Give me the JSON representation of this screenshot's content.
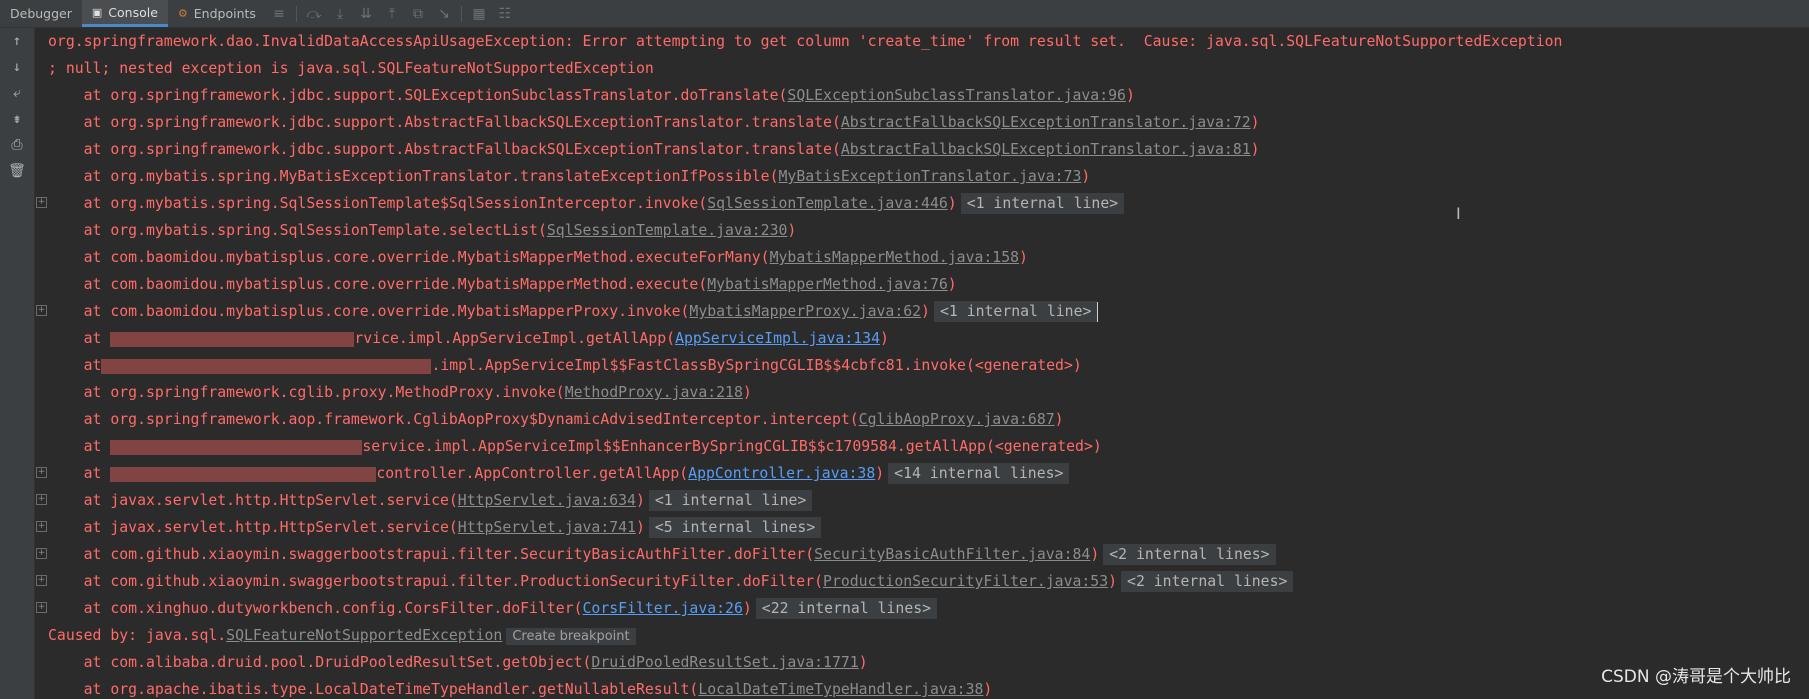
{
  "tabs": [
    {
      "label": "Debugger",
      "icon": ""
    },
    {
      "label": "Console",
      "icon": "console-icon"
    },
    {
      "label": "Endpoints",
      "icon": "endpoints-icon"
    }
  ],
  "toolbar_icons": [
    "menu-icon",
    "step-over-icon",
    "step-into-icon",
    "force-step-into-icon",
    "step-out-icon",
    "drop-frame-icon",
    "run-to-cursor-icon",
    "evaluate-icon",
    "trace-icon"
  ],
  "side_icons": [
    "up-arrow-icon",
    "down-arrow-icon",
    "soft-wrap-icon",
    "scroll-to-end-icon",
    "print-icon",
    "trash-icon"
  ],
  "colors": {
    "error": "#ff6b68",
    "link": "#8c8c8c",
    "link_blue": "#589df6",
    "fold_text": "#b4b4b4"
  },
  "console": {
    "line1": "org.springframework.dao.InvalidDataAccessApiUsageException: Error attempting to get column 'create_time' from result set.  Cause: java.sql.SQLFeatureNotSupportedException",
    "line2": "; null; nested exception is java.sql.SQLFeatureNotSupportedException",
    "frames": [
      {
        "text": "    at org.springframework.jdbc.support.SQLExceptionSubclassTranslator.doTranslate(",
        "link": "SQLExceptionSubclassTranslator.java:96",
        "tail": ")",
        "fold": "",
        "blue": false,
        "gutter": false
      },
      {
        "text": "    at org.springframework.jdbc.support.AbstractFallbackSQLExceptionTranslator.translate(",
        "link": "AbstractFallbackSQLExceptionTranslator.java:72",
        "tail": ")",
        "fold": "",
        "blue": false,
        "gutter": false
      },
      {
        "text": "    at org.springframework.jdbc.support.AbstractFallbackSQLExceptionTranslator.translate(",
        "link": "AbstractFallbackSQLExceptionTranslator.java:81",
        "tail": ")",
        "fold": "",
        "blue": false,
        "gutter": false
      },
      {
        "text": "    at org.mybatis.spring.MyBatisExceptionTranslator.translateExceptionIfPossible(",
        "link": "MyBatisExceptionTranslator.java:73",
        "tail": ")",
        "fold": "",
        "blue": false,
        "gutter": false
      },
      {
        "text": "    at org.mybatis.spring.SqlSessionTemplate$SqlSessionInterceptor.invoke(",
        "link": "SqlSessionTemplate.java:446",
        "tail": ")",
        "fold": "<1 internal line>",
        "blue": false,
        "gutter": true
      },
      {
        "text": "    at org.mybatis.spring.SqlSessionTemplate.selectList(",
        "link": "SqlSessionTemplate.java:230",
        "tail": ")",
        "fold": "",
        "blue": false,
        "gutter": false
      },
      {
        "text": "    at com.baomidou.mybatisplus.core.override.MybatisMapperMethod.executeForMany(",
        "link": "MybatisMapperMethod.java:158",
        "tail": ")",
        "fold": "",
        "blue": false,
        "gutter": false
      },
      {
        "text": "    at com.baomidou.mybatisplus.core.override.MybatisMapperMethod.execute(",
        "link": "MybatisMapperMethod.java:76",
        "tail": ")",
        "fold": "",
        "blue": false,
        "gutter": false
      },
      {
        "text": "    at com.baomidou.mybatisplus.core.override.MybatisMapperProxy.invoke(",
        "link": "MybatisMapperProxy.java:62",
        "tail": ")",
        "fold": "<1 internal line>",
        "blue": false,
        "gutter": true,
        "cursor": true
      },
      {
        "text": "    at ",
        "redact": "r1",
        "text2": "rvice.impl.AppServiceImpl.getAllApp(",
        "link": "AppServiceImpl.java:134",
        "tail": ")",
        "fold": "",
        "blue": true,
        "gutter": false
      },
      {
        "text": "    at",
        "redact": "r2",
        "text2": ".impl.AppServiceImpl$$FastClassBySpringCGLIB$$4cbfc81.invoke(<generated>)",
        "link": "",
        "tail": "",
        "fold": "",
        "blue": false,
        "gutter": false
      },
      {
        "text": "    at org.springframework.cglib.proxy.MethodProxy.invoke(",
        "link": "MethodProxy.java:218",
        "tail": ")",
        "fold": "",
        "blue": false,
        "gutter": false
      },
      {
        "text": "    at org.springframework.aop.framework.CglibAopProxy$DynamicAdvisedInterceptor.intercept(",
        "link": "CglibAopProxy.java:687",
        "tail": ")",
        "fold": "",
        "blue": false,
        "gutter": false
      },
      {
        "text": "    at ",
        "redact": "r3",
        "text2": "service.impl.AppServiceImpl$$EnhancerBySpringCGLIB$$c1709584.getAllApp(<generated>)",
        "link": "",
        "tail": "",
        "fold": "",
        "blue": false,
        "gutter": false
      },
      {
        "text": "    at ",
        "redact": "r4",
        "text2": "controller.AppController.getAllApp(",
        "link": "AppController.java:38",
        "tail": ")",
        "fold": "<14 internal lines>",
        "blue": true,
        "gutter": true
      },
      {
        "text": "    at javax.servlet.http.HttpServlet.service(",
        "link": "HttpServlet.java:634",
        "tail": ")",
        "fold": "<1 internal line>",
        "blue": false,
        "gutter": true
      },
      {
        "text": "    at javax.servlet.http.HttpServlet.service(",
        "link": "HttpServlet.java:741",
        "tail": ")",
        "fold": "<5 internal lines>",
        "blue": false,
        "gutter": true
      },
      {
        "text": "    at com.github.xiaoymin.swaggerbootstrapui.filter.SecurityBasicAuthFilter.doFilter(",
        "link": "SecurityBasicAuthFilter.java:84",
        "tail": ")",
        "fold": "<2 internal lines>",
        "blue": false,
        "gutter": true
      },
      {
        "text": "    at com.github.xiaoymin.swaggerbootstrapui.filter.ProductionSecurityFilter.doFilter(",
        "link": "ProductionSecurityFilter.java:53",
        "tail": ")",
        "fold": "<2 internal lines>",
        "blue": false,
        "gutter": true
      },
      {
        "text": "    at com.xinghuo.dutyworkbench.config.CorsFilter.doFilter(",
        "link": "CorsFilter.java:26",
        "tail": ")",
        "fold": "<22 internal lines>",
        "blue": true,
        "gutter": true
      }
    ],
    "caused_prefix": "Caused by: java.sql.",
    "caused_link": "SQLFeatureNotSupportedException",
    "create_breakpoint": "Create breakpoint",
    "frames2": [
      {
        "text": "    at com.alibaba.druid.pool.DruidPooledResultSet.getObject(",
        "link": "DruidPooledResultSet.java:1771",
        "tail": ")"
      },
      {
        "text": "    at org.apache.ibatis.type.LocalDateTimeTypeHandler.getNullableResult(",
        "link": "LocalDateTimeTypeHandler.java:38",
        "tail": ")"
      }
    ]
  },
  "watermark": "CSDN @涛哥是个大帅比"
}
